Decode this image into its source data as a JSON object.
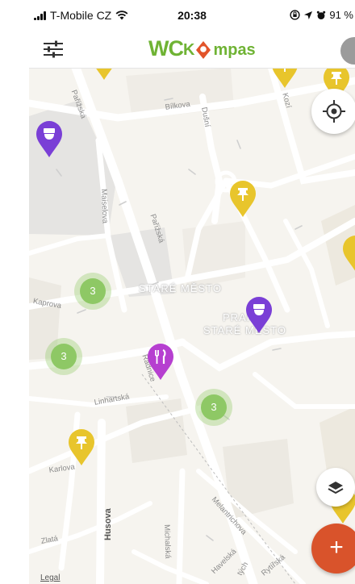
{
  "status_bar": {
    "carrier": "T-Mobile CZ",
    "time": "20:38",
    "battery": "91 %"
  },
  "app_bar": {
    "logo_prefix": "WC",
    "logo_suffix": "mpas",
    "icons": [
      "filter-sliders-icon",
      "logo-pin-icon",
      "avatar"
    ]
  },
  "map": {
    "district_labels": [
      "STARÉ MĚSTO",
      "PRAHA",
      "STARÉ MĚSTO"
    ],
    "streets": [
      "Pařížská",
      "Bílkova",
      "Dušní",
      "Kozí",
      "Maiselova",
      "Pařížská",
      "Kaprova",
      "Radnice",
      "Linhartská",
      "Karlova",
      "Zlatá",
      "Husova",
      "Michalská",
      "Melantrichova",
      "Havelská",
      "Rytířská",
      "tých"
    ],
    "clusters": [
      "3",
      "3",
      "3"
    ],
    "pin_colors": {
      "toilet": "#7a3fd6",
      "restaurant": "#b63fd0",
      "attraction": "#e8c52c"
    }
  },
  "controls": {
    "add_label": "+",
    "legal_label": "Legal",
    "icons": [
      "locate-icon",
      "layers-icon",
      "add-icon"
    ]
  }
}
